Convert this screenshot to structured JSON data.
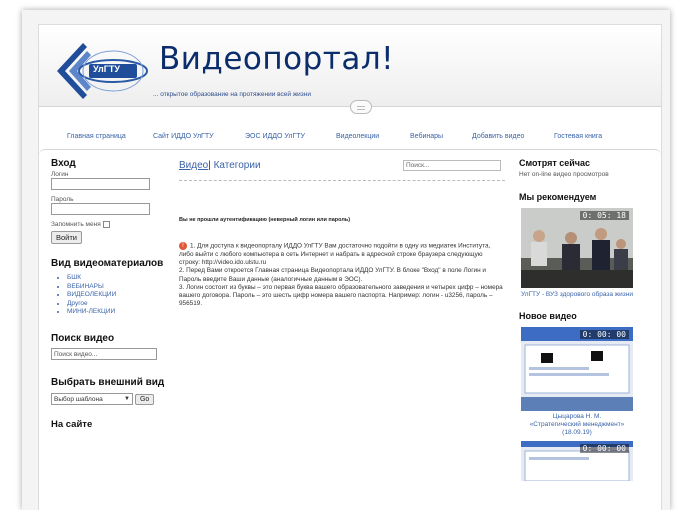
{
  "header": {
    "logo_text": "УлГТУ",
    "title": "Видеопортал!",
    "subtitle": "... открытое образование на протяжении всей жизни"
  },
  "nav": {
    "items": [
      {
        "label": "Главная страница"
      },
      {
        "label": "Сайт ИДДО УлГТУ"
      },
      {
        "label": "ЭОС ИДДО УлГТУ"
      },
      {
        "label": "Видеолекции"
      },
      {
        "label": "Вебинары"
      },
      {
        "label": "Добавить видео"
      },
      {
        "label": "Гостевая книга"
      }
    ]
  },
  "login": {
    "heading": "Вход",
    "login_label": "Логин",
    "password_label": "Пароль",
    "remember_label": "Запомнить меня",
    "submit_label": "Войти"
  },
  "materials": {
    "heading": "Вид видеоматериалов",
    "items": [
      "БШК",
      "ВЕБИНАРЫ",
      "ВИДЕОЛЕКЦИИ",
      "Другое",
      "МИНИ-ЛЕКЦИИ"
    ]
  },
  "video_search": {
    "heading": "Поиск видео",
    "placeholder": "Поиск видео..."
  },
  "theme": {
    "heading": "Выбрать внешний вид",
    "selected": "Выбор шаблона",
    "go_label": "Go"
  },
  "on_site": {
    "heading": "На сайте"
  },
  "main": {
    "tab_video": "Видео",
    "tab_separator": "|",
    "tab_categories": "Категории",
    "search_placeholder": "Поиск...",
    "error": "Вы не прошли аутентификацию (неверный логин или пароль)",
    "info_p1": "1. Для доступа к видеопорталу ИДДО УлГТУ Вам достаточно подойти в одну из медиатек Института, либо выйти с любого компьютера в сеть Интернет и набрать в адресной строке браузера следующую строку: http://video.ido.ulstu.ru",
    "info_p2": "2. Перед Вами откроется Главная страница Видеопортала ИДДО УлГТУ. В блоке \"Вход\" в поле Логин и Пароль введите Ваши данные (аналогичные данным в ЭОС).",
    "info_p3": "3. Логин состоит из буквы – это первая буква вашего образовательного заведения и четырех цифр – номера вашего договора. Пароль – это шесть цифр номера вашего паспорта. Например: логин - u3256, пароль – 956519."
  },
  "sidebar_right": {
    "watching_heading": "Смотрят сейчас",
    "watching_text": "Нет on-line видео просмотров",
    "recommend_heading": "Мы рекомендуем",
    "recommend_time": "0: 05: 18",
    "recommend_caption": "УлГТУ - ВУЗ здорового образа жизни",
    "new_heading": "Новое видео",
    "new_time_1": "0: 00: 00",
    "new_caption_1": "Цыцарова Н. М.",
    "new_caption_2": "«Стратегический менеджмент»",
    "new_caption_3": "(18.09.19)",
    "new_time_2": "0: 00: 00"
  },
  "colors": {
    "title_blue": "#0c2d6b",
    "link_blue": "#3a63a8",
    "info_icon": "#e2573a"
  }
}
